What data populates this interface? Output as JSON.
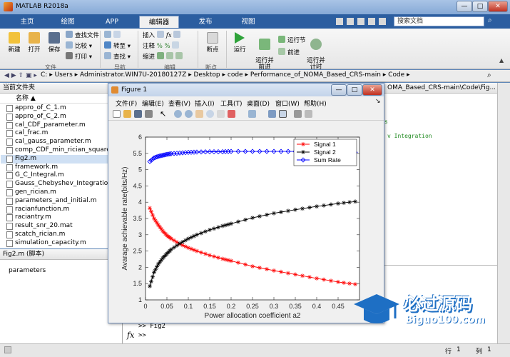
{
  "window": {
    "title": "MATLAB R2018a",
    "min": "—",
    "max": "□",
    "close": "✕"
  },
  "tabs": [
    "主页",
    "绘图",
    "APP",
    "编辑器",
    "发布",
    "视图"
  ],
  "search": {
    "placeholder": "搜索文档"
  },
  "ribbon": {
    "file": {
      "new": "新建",
      "open": "打开",
      "save": "保存",
      "find_files": "查找文件",
      "compare": "比较",
      "print": "打印",
      "group": "文件"
    },
    "nav": {
      "goto": "转至",
      "find": "查找",
      "group": "导航"
    },
    "edit": {
      "insert": "插入",
      "fx": "fx",
      "comment": "注释",
      "indent": "缩进",
      "group": "编辑"
    },
    "breakpoints": {
      "label": "断点",
      "group": "断点"
    },
    "run": {
      "run": "运行",
      "run_advance": "运行并\n前进",
      "run_section": "运行节",
      "advance": "前进",
      "run_time": "运行并\n计时"
    }
  },
  "address": {
    "path": [
      "C:",
      "Users",
      "Administrator.WIN7U-20180127Z",
      "Desktop",
      "code",
      "Performance_of_NOMA_Based_CRS-main",
      "Code"
    ]
  },
  "current_folder": {
    "title": "当前文件夹",
    "column": "名称",
    "files": [
      "appro_of_C_1.m",
      "appro_of_C_2.m",
      "cal_CDF_parameter.m",
      "cal_frac.m",
      "cal_gauss_parameter.m",
      "comp_CDF_min_rician_square.m",
      "Fig2.m",
      "framework.m",
      "G_C_Integral.m",
      "Gauss_Chebyshev_Integration.m",
      "gen_rician.m",
      "parameters_and_initial.m",
      "racianfunction.m",
      "raciantry.m",
      "result_snr_20.mat",
      "scatch_rician.m",
      "simulation_capacity.m"
    ],
    "selected": "Fig2.m"
  },
  "details": {
    "title": "Fig2.m  (脚本)",
    "text": "parameters"
  },
  "editor": {
    "path": "OMA_Based_CRS-main\\Code\\Fig...",
    "line": "v Integration"
  },
  "command": {
    "prompt": ">> Fig2",
    "fx": "fx",
    "prompt2": ">>"
  },
  "status": {
    "row_label": "行",
    "row": "1",
    "col_label": "列",
    "col": "1"
  },
  "figure": {
    "title": "Figure 1",
    "menu": [
      "文件(F)",
      "编辑(E)",
      "查看(V)",
      "插入(I)",
      "工具(T)",
      "桌面(D)",
      "窗口(W)",
      "帮助(H)"
    ]
  },
  "chart_data": {
    "type": "line",
    "xlabel": "Power allocation coefficient a2",
    "ylabel": "Avarage achievable rate(bits/Hz)",
    "xlim": [
      0,
      0.5
    ],
    "ylim": [
      1,
      6
    ],
    "xticks": [
      "0",
      "0.05",
      "0.1",
      "0.15",
      "0.2",
      "0.25",
      "0.3",
      "0.35",
      "0.4",
      "0.45"
    ],
    "yticks": [
      "1",
      "1.5",
      "2",
      "2.5",
      "3",
      "3.5",
      "4",
      "4.5",
      "5",
      "5.5",
      "6"
    ],
    "legend_position": "top-right",
    "grid": false,
    "series": [
      {
        "name": "Signal 1",
        "color": "#ff0000",
        "marker": "star",
        "x": [
          0.01,
          0.02,
          0.03,
          0.04,
          0.05,
          0.06,
          0.08,
          0.1,
          0.12,
          0.15,
          0.18,
          0.2,
          0.25,
          0.3,
          0.35,
          0.4,
          0.45,
          0.49
        ],
        "y": [
          3.82,
          3.5,
          3.3,
          3.12,
          2.98,
          2.88,
          2.72,
          2.6,
          2.5,
          2.37,
          2.26,
          2.2,
          2.03,
          1.9,
          1.78,
          1.66,
          1.55,
          1.48
        ]
      },
      {
        "name": "Signal 2",
        "color": "#000000",
        "marker": "star",
        "x": [
          0.01,
          0.02,
          0.03,
          0.04,
          0.05,
          0.06,
          0.08,
          0.1,
          0.12,
          0.15,
          0.18,
          0.2,
          0.25,
          0.3,
          0.35,
          0.4,
          0.45,
          0.49
        ],
        "y": [
          1.42,
          1.85,
          2.1,
          2.28,
          2.42,
          2.55,
          2.73,
          2.88,
          3.0,
          3.15,
          3.27,
          3.34,
          3.52,
          3.66,
          3.77,
          3.87,
          3.96,
          4.02
        ]
      },
      {
        "name": "Sum Rate",
        "color": "#0000ff",
        "marker": "diamond",
        "x": [
          0.01,
          0.02,
          0.03,
          0.04,
          0.05,
          0.06,
          0.08,
          0.1,
          0.12,
          0.15,
          0.18,
          0.2,
          0.25,
          0.3,
          0.35,
          0.4,
          0.45,
          0.49
        ],
        "y": [
          5.25,
          5.36,
          5.41,
          5.44,
          5.47,
          5.49,
          5.51,
          5.53,
          5.54,
          5.55,
          5.55,
          5.56,
          5.56,
          5.56,
          5.56,
          5.55,
          5.54,
          5.53
        ]
      }
    ]
  },
  "watermark": {
    "cn": "必过源码",
    "url": "Biguo100.com"
  }
}
